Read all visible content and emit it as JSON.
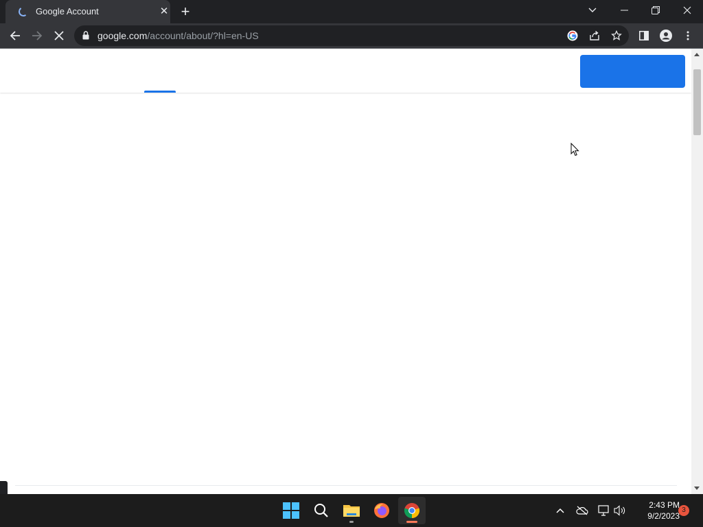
{
  "browser": {
    "tab": {
      "title": "Google Account"
    },
    "omnibox": {
      "url_host": "google.com",
      "url_path": "/account/about/?hl=en-US"
    }
  },
  "page": {
    "state": "loading",
    "accent_color": "#1a73e8"
  },
  "taskbar": {
    "apps": [
      "start-icon",
      "search-icon",
      "file-explorer-icon",
      "firefox-icon",
      "chrome-icon"
    ],
    "active_app": "chrome-icon",
    "clock": {
      "time": "2:43 PM",
      "date": "9/2/2023"
    },
    "notification_count": "3"
  },
  "colors": {
    "chrome_dark": "#202124",
    "chrome_toolbar": "#35363a",
    "taskbar": "#1c1c1c",
    "primary_blue": "#1a73e8",
    "badge_red": "#e8543d"
  }
}
